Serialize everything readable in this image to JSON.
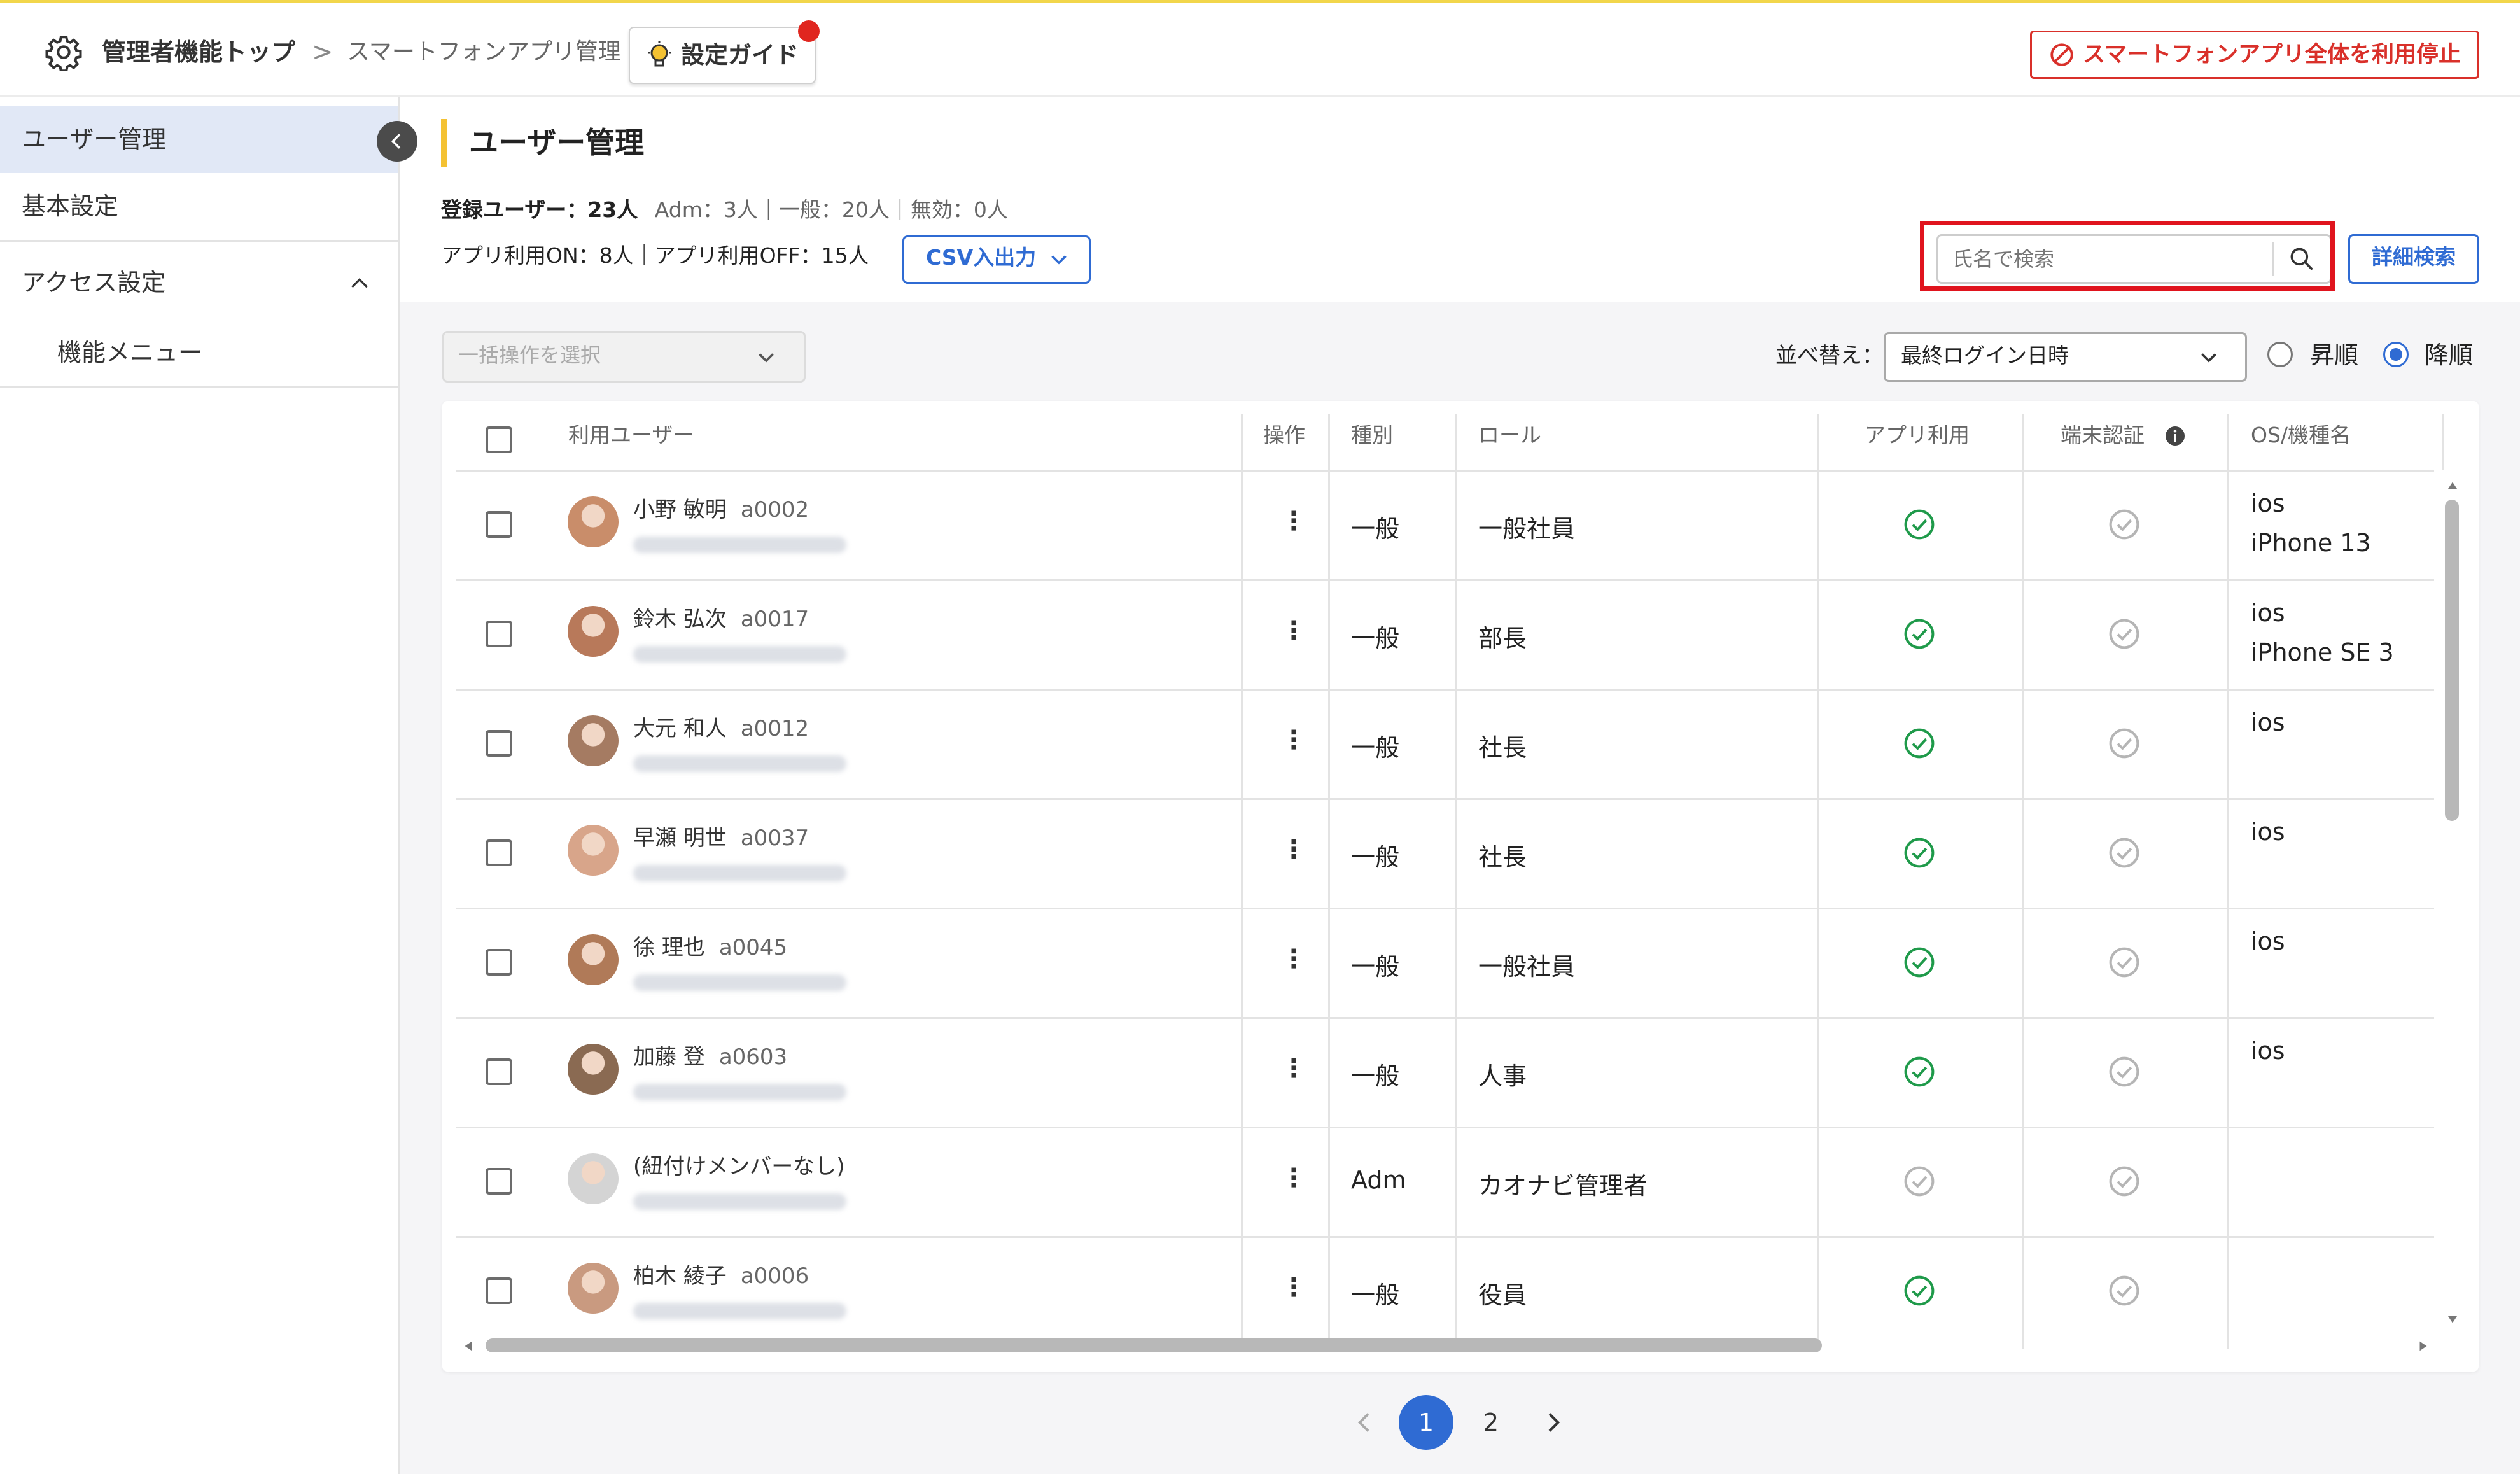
{
  "colors": {
    "accent": "#2f6bd3",
    "danger": "#d9302a",
    "success": "#1f9a4a",
    "muted": "#b5b5b5",
    "highlight": "#f4c233"
  },
  "header": {
    "breadcrumb_root": "管理者機能トップ",
    "breadcrumb_sep": ">",
    "breadcrumb_current": "スマートフォンアプリ管理",
    "guide_label": "設定ガイド",
    "stop_label": "スマートフォンアプリ全体を利用停止"
  },
  "sidebar": {
    "items": [
      {
        "label": "ユーザー管理",
        "active": true
      },
      {
        "label": "基本設定"
      },
      {
        "label": "アクセス設定",
        "expanded": true
      },
      {
        "label": "機能メニュー"
      }
    ]
  },
  "main": {
    "title": "ユーザー管理",
    "stats_line1_bold": "登録ユーザー：23人",
    "stats_line1_rest": "Adm：3人｜一般：20人｜無効：0人",
    "stats_line2": "アプリ利用ON：8人｜アプリ利用OFF：15人",
    "csv_label": "CSV入出力",
    "search_placeholder": "氏名で検索",
    "search_value": "",
    "advanced_search_label": "詳細検索",
    "bulk_placeholder": "一括操作を選択",
    "sort_label": "並べ替え：",
    "sort_value": "最終ログイン日時",
    "order_asc": "昇順",
    "order_desc": "降順",
    "order_selected": "desc"
  },
  "table": {
    "headers": [
      "利用ユーザー",
      "操作",
      "種別",
      "ロール",
      "アプリ利用",
      "端末認証",
      "OS/機種名"
    ],
    "rows": [
      {
        "name": "小野 敏明",
        "id": "a0002",
        "op": "⋮",
        "type": "一般",
        "role": "一般社員",
        "app": true,
        "device": false,
        "os": "ios",
        "model": "iPhone 13",
        "avatar": "#c98d6a"
      },
      {
        "name": "鈴木 弘次",
        "id": "a0017",
        "op": "⋮",
        "type": "一般",
        "role": "部長",
        "app": true,
        "device": false,
        "os": "ios",
        "model": "iPhone SE 3",
        "avatar": "#b8795a"
      },
      {
        "name": "大元 和人",
        "id": "a0012",
        "op": "⋮",
        "type": "一般",
        "role": "社長",
        "app": true,
        "device": false,
        "os": "ios",
        "model": "",
        "avatar": "#a57b62"
      },
      {
        "name": "早瀬 明世",
        "id": "a0037",
        "op": "⋮",
        "type": "一般",
        "role": "社長",
        "app": true,
        "device": false,
        "os": "ios",
        "model": "",
        "avatar": "#d8a58a"
      },
      {
        "name": "徐 理也",
        "id": "a0045",
        "op": "⋮",
        "type": "一般",
        "role": "一般社員",
        "app": true,
        "device": false,
        "os": "ios",
        "model": "",
        "avatar": "#b07a58"
      },
      {
        "name": "加藤 登",
        "id": "a0603",
        "op": "⋮",
        "type": "一般",
        "role": "人事",
        "app": true,
        "device": false,
        "os": "ios",
        "model": "",
        "avatar": "#8a6a52"
      },
      {
        "name": "(紐付けメンバーなし)",
        "id": "",
        "op": "⋮",
        "type": "Adm",
        "role": "カオナビ管理者",
        "app": false,
        "device": false,
        "os": "",
        "model": "",
        "avatar": "#d4d4d4"
      },
      {
        "name": "柏木 綾子",
        "id": "a0006",
        "op": "⋮",
        "type": "一般",
        "role": "役員",
        "app": true,
        "device": false,
        "os": "",
        "model": "",
        "avatar": "#c99a80"
      }
    ]
  },
  "pagination": {
    "pages": [
      "1",
      "2"
    ],
    "current": "1"
  }
}
